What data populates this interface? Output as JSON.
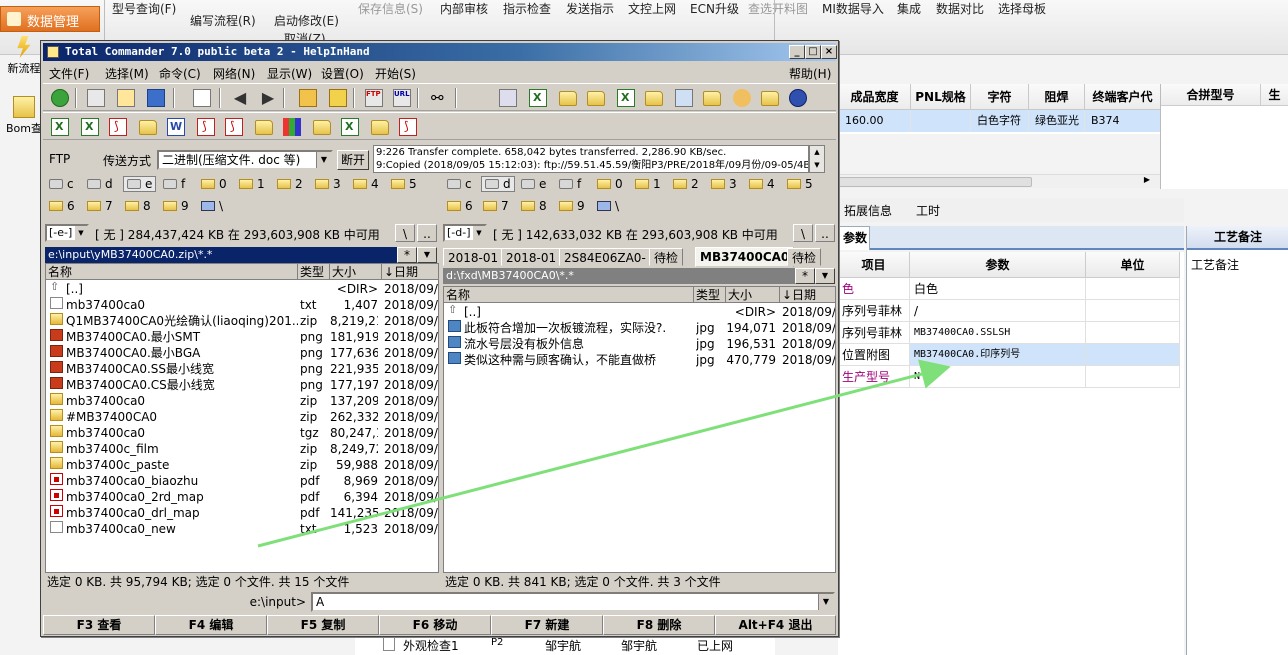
{
  "background_app": {
    "top_menu": [
      "型号查询(F)",
      "编写流程(R)",
      "启动修改(E)",
      "保存信息(S)",
      "内部审核",
      "指示检查",
      "发送指示",
      "文控上网",
      "ECN升级",
      "查选开料图",
      "MI数据导入",
      "集成",
      "数据对比",
      "选择母板"
    ],
    "sub_menu": [
      "取消(Z)"
    ],
    "left_nav_title": "数据管理",
    "left_icons": [
      "新流程",
      "Bom查"
    ],
    "grid_headers": [
      "成品宽度",
      "PNL规格",
      "字符",
      "阻焊",
      "终端客户代"
    ],
    "grid_row": [
      "160.00",
      "",
      "白色字符",
      "绿色亚光",
      "B374"
    ],
    "right_grid_headers": [
      "合拼型号",
      "生"
    ],
    "tabs": [
      "拓展信息",
      "工时"
    ],
    "param_tab": "参数",
    "param_headers": [
      "项目",
      "参数",
      "单位"
    ],
    "param_rows": [
      {
        "item": "色",
        "value": "白色"
      },
      {
        "item": "序列号菲林",
        "value": "/"
      },
      {
        "item": "序列号菲林",
        "value": "MB37400CA0.SSLSH"
      },
      {
        "item": "位置附图",
        "value": "MB37400CA0.印序列号"
      },
      {
        "item": "生产型号",
        "value": "N"
      }
    ],
    "side_tab": "工艺备注",
    "side_label": "工艺备注",
    "bottom_row": [
      "外观检查1",
      "P2",
      "邹宇航",
      "邹宇航",
      "已上网"
    ]
  },
  "tc": {
    "title": "Total Commander 7.0 public beta 2 - HelpInHand",
    "window_buttons": [
      "_",
      "□",
      "×"
    ],
    "menu": [
      "文件(F)",
      "选择(M)",
      "命令(C)",
      "网络(N)",
      "显示(W)",
      "设置(O)",
      "开始(S)"
    ],
    "help": "帮助(H)",
    "ftp": {
      "label": "FTP",
      "mode_label": "传送方式",
      "mode_value": "二进制(压缩文件. doc 等)",
      "disconnect": "断开",
      "log": [
        "9:226 Transfer complete. 658,042 bytes transferred. 2,286.90 KB/sec.",
        "9:Copied (2018/09/05 15:12:03): ftp://59.51.45.59/衡阳P3/PRE/2018年/09月份/09-05/4B"
      ]
    },
    "drives_row1": [
      "c",
      "d",
      "e",
      "f",
      "0",
      "1",
      "2",
      "3",
      "4",
      "5"
    ],
    "drives_row2": [
      "6",
      "7",
      "8",
      "9",
      "\\"
    ],
    "left": {
      "drive": "[-e-]",
      "info": "[ 无 ]  284,437,424 KB 在 293,603,908 KB 中可用",
      "btn_root": "\\",
      "btn_up": "..",
      "path": "e:\\input\\yMB37400CA0.zip\\*.*",
      "filter": "*",
      "columns": [
        "名称",
        "类型",
        "大小",
        "↓日期"
      ],
      "files": [
        {
          "icon": "up",
          "name": "[..]",
          "type": "",
          "size": "<DIR>",
          "date": "2018/09/"
        },
        {
          "icon": "txt",
          "name": "mb37400ca0",
          "type": "txt",
          "size": "1,407",
          "date": "2018/09/"
        },
        {
          "icon": "zip",
          "name": "Q1MB37400CA0光绘确认(liaoqing)201..",
          "type": "zip",
          "size": "8,219,218",
          "date": "2018/09/"
        },
        {
          "icon": "png",
          "name": "MB37400CA0.最小SMT",
          "type": "png",
          "size": "181,919",
          "date": "2018/09/"
        },
        {
          "icon": "png",
          "name": "MB37400CA0.最小BGA",
          "type": "png",
          "size": "177,636",
          "date": "2018/09/"
        },
        {
          "icon": "png",
          "name": "MB37400CA0.SS最小线宽",
          "type": "png",
          "size": "221,935",
          "date": "2018/09/"
        },
        {
          "icon": "png",
          "name": "MB37400CA0.CS最小线宽",
          "type": "png",
          "size": "177,197",
          "date": "2018/09/"
        },
        {
          "icon": "zip",
          "name": "mb37400ca0",
          "type": "zip",
          "size": "137,209",
          "date": "2018/09/"
        },
        {
          "icon": "zip",
          "name": "#MB37400CA0",
          "type": "zip",
          "size": "262,332",
          "date": "2018/09/"
        },
        {
          "icon": "zip",
          "name": "mb37400ca0",
          "type": "tgz",
          "size": "80,247,131",
          "date": "2018/09/"
        },
        {
          "icon": "zip",
          "name": "mb37400c_film",
          "type": "zip",
          "size": "8,249,723",
          "date": "2018/09/"
        },
        {
          "icon": "zip",
          "name": "mb37400c_paste",
          "type": "zip",
          "size": "59,988",
          "date": "2018/09/"
        },
        {
          "icon": "pdf",
          "name": "mb37400ca0_biaozhu",
          "type": "pdf",
          "size": "8,969",
          "date": "2018/09/"
        },
        {
          "icon": "pdf",
          "name": "mb37400ca0_2rd_map",
          "type": "pdf",
          "size": "6,394",
          "date": "2018/09/"
        },
        {
          "icon": "pdf",
          "name": "mb37400ca0_drl_map",
          "type": "pdf",
          "size": "141,235",
          "date": "2018/09/"
        },
        {
          "icon": "txt",
          "name": "mb37400ca0_new",
          "type": "txt",
          "size": "1,523",
          "date": "2018/09/"
        }
      ],
      "status": "选定 0 KB. 共 95,794 KB; 选定 0 个文件. 共 15 个文件"
    },
    "right": {
      "drive": "[-d-]",
      "info": "[ 无 ]  142,633,032 KB 在 293,603,908 KB 中可用",
      "btn_root": "\\",
      "btn_up": "..",
      "tabs": [
        "2018-01",
        "2018-01",
        "2S84E06ZA0-",
        "待检",
        "MB37400CA0",
        "待检"
      ],
      "active_tab": 4,
      "path": "d:\\fxd\\MB37400CA0\\*.*",
      "filter": "*",
      "columns": [
        "名称",
        "类型",
        "大小",
        "↓日期"
      ],
      "files": [
        {
          "icon": "up",
          "name": "[..]",
          "type": "",
          "size": "<DIR>",
          "date": "2018/09/"
        },
        {
          "icon": "jpg",
          "name": "此板符合增加一次板镀流程，实际没?.",
          "type": "jpg",
          "size": "194,071",
          "date": "2018/09/"
        },
        {
          "icon": "jpg",
          "name": "流水号层没有板外信息",
          "type": "jpg",
          "size": "196,531",
          "date": "2018/09/"
        },
        {
          "icon": "jpg",
          "name": "类似这种需与顾客确认，不能直做桥",
          "type": "jpg",
          "size": "470,779",
          "date": "2018/09/"
        }
      ],
      "status": "选定 0 KB. 共 841 KB; 选定 0 个文件. 共 3 个文件"
    },
    "cmdline": {
      "label": "e:\\input>",
      "value": "A"
    },
    "fkeys": [
      "F3 查看",
      "F4 编辑",
      "F5 复制",
      "F6 移动",
      "F7 新建",
      "F8 删除",
      "Alt+F4 退出"
    ]
  },
  "annotation": {
    "color": "#7fe07a"
  }
}
